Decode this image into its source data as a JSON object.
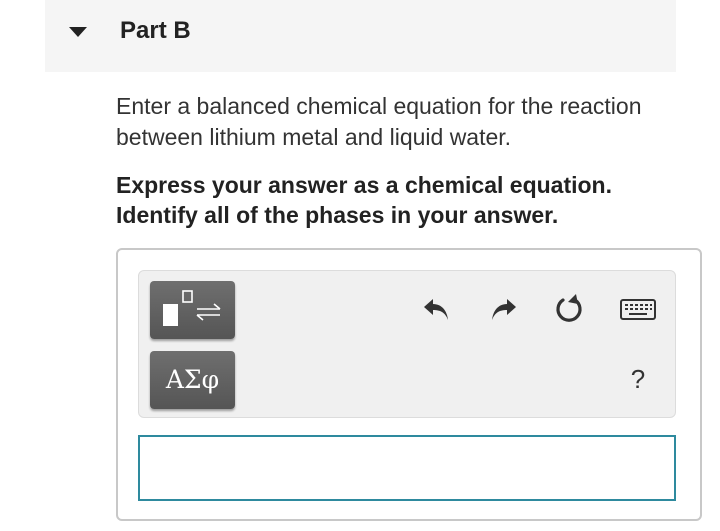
{
  "part": {
    "title": "Part B",
    "expanded": true
  },
  "prompt": {
    "question": "Enter a balanced chemical equation for the reaction between lithium metal and liquid water.",
    "instructions": "Express your answer as a chemical equation. Identify all of the phases in your answer."
  },
  "toolbar": {
    "chem_template_icon": "chemistry-template-icon",
    "greek_label": "ΑΣφ",
    "undo_icon": "undo-icon",
    "redo_icon": "redo-icon",
    "reset_icon": "reset-icon",
    "keyboard_icon": "keyboard-icon",
    "help_label": "?"
  },
  "answer": {
    "value": ""
  },
  "colors": {
    "header_bg": "#f5f5f5",
    "button_bg": "#5f5f5f",
    "input_border": "#2e8a9e",
    "toolbar_bg": "#f0f0f0"
  }
}
